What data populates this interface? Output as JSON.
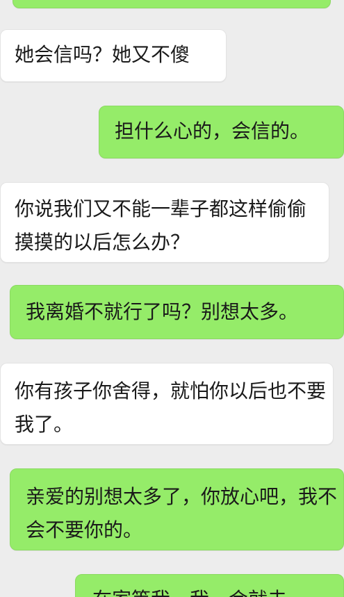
{
  "messages": [
    {
      "side": "out",
      "text": ""
    },
    {
      "side": "in",
      "text": "她会信吗？她又不傻"
    },
    {
      "side": "out",
      "text": "担什么心的，会信的。"
    },
    {
      "side": "in",
      "text": "你说我们又不能一辈子都这样偷偷摸摸的以后怎么办？"
    },
    {
      "side": "out",
      "text": "我离婚不就行了吗？别想太多。"
    },
    {
      "side": "in",
      "text": "你有孩子你舍得，就怕你以后也不要我了。"
    },
    {
      "side": "out",
      "text": "亲爱的别想太多了，你放心吧，我不会不要你的。"
    },
    {
      "side": "out",
      "text": "在家等我，我一会就去"
    }
  ],
  "colors": {
    "background": "#ededed",
    "incoming_bubble": "#ffffff",
    "outgoing_bubble": "#95ec69"
  }
}
